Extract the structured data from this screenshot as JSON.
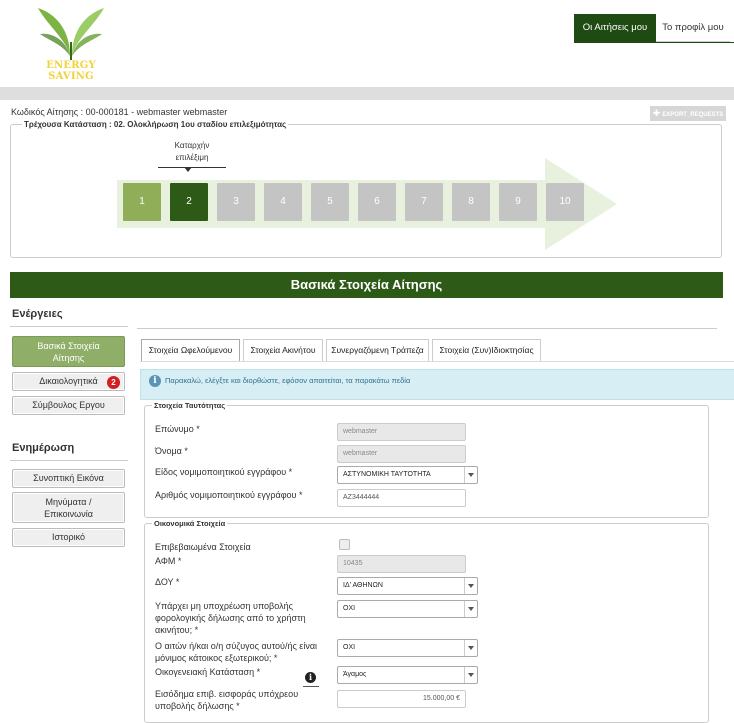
{
  "header": {
    "logo_text": "ENERGY SAVING",
    "nav": {
      "my_applications": "Οι Αιτήσεις μου",
      "my_profile": "Το προφίλ μου"
    }
  },
  "application": {
    "code_line": "Κωδικός Αίτησης : 00-000181 - webmaster webmaster",
    "current_status": "Τρέχουσα Κατάσταση : 02. Ολοκλήρωση 1ου σταδίου επιλεξιμότητας",
    "export_label": "EXPORT_REQUESTS"
  },
  "progress": {
    "tooltip_line1": "Καταρχήν",
    "tooltip_line2": "επιλέξιμη",
    "current_step": 2,
    "steps": [
      "1",
      "2",
      "3",
      "4",
      "5",
      "6",
      "7",
      "8",
      "9",
      "10"
    ],
    "colors": {
      "done": "#8fae57",
      "current": "#2d5a17",
      "pending": "#c4c4c4",
      "arrow": "#e8f0de"
    }
  },
  "section_title": "Βασικά Στοιχεία Αίτησης",
  "sidebar": {
    "actions_heading": "Ενέργειες",
    "actions": {
      "basic_line1": "Βασικά Στοιχεία",
      "basic_line2": "Αίτησης",
      "documents": "Δικαιολογητικά",
      "documents_badge": "2",
      "advisor": "Σύμβουλος Εργου"
    },
    "updates_heading": "Ενημέρωση",
    "updates": {
      "summary": "Συνοπτική Εικόνα",
      "messages_line1": "Μηνύματα /",
      "messages_line2": "Επικοινωνία",
      "history": "Ιστορικό"
    }
  },
  "tabs": {
    "beneficiary": "Στοιχεία Ωφελούμενου",
    "property": "Στοιχεία Ακινήτου",
    "bank": "Συνεργαζόμενη Τράπεζα",
    "ownership": "Στοιχεία (Συν)Ιδιοκτησίας"
  },
  "alert": {
    "text": "Παρακαλώ, ελέγξτε και διορθώστε, εφόσον απαιτείται, τα παρακάτω πεδία"
  },
  "identity": {
    "legend": "Στοιχεία Ταυτότητας",
    "surname_label": "Επώνυμο *",
    "surname_value": "webmaster",
    "name_label": "Όνομα *",
    "name_value": "webmaster",
    "doc_type_label": "Είδος νομιμοποιητικού εγγράφου *",
    "doc_type_value": "ΑΣΤΥΝΟΜΙΚΗ ΤΑΥΤΟΤΗΤΑ",
    "doc_number_label": "Αριθμός νομιμοποιητικού εγγράφου *",
    "doc_number_value": "ΑΖ3444444"
  },
  "financial": {
    "legend": "Οικονομικά Στοιχεία",
    "verified_label": "Επιβεβαιωμένα Στοιχεία",
    "afm_label": "ΑΦΜ *",
    "afm_value": "10435",
    "doy_label": "ΔΟΥ *",
    "doy_value": "ΙΔ' ΑΘΗΝΩΝ",
    "tax_line1": "Υπάρχει μη υποχρέωση υποβολής",
    "tax_line2": "φορολογικής δήλωσης από το χρήστη",
    "tax_line3": "ακινήτου; *",
    "tax_value": "ΟΧΙ",
    "abroad_line1": "Ο αιτών ή/και ο/η σύζυγος αυτού/ής είναι",
    "abroad_line2": "μόνιμος κάτοικος εξωτερικού; *",
    "abroad_value": "ΟΧΙ",
    "family_label": "Οικογενειακή Κατάσταση *",
    "family_value": "Άγαμος",
    "income_line1": "Εισόδημα επιβ. εισφοράς υπόχρεου",
    "income_line2": "υποβολής δήλωσης *",
    "income_value": "15.000,00 €"
  }
}
